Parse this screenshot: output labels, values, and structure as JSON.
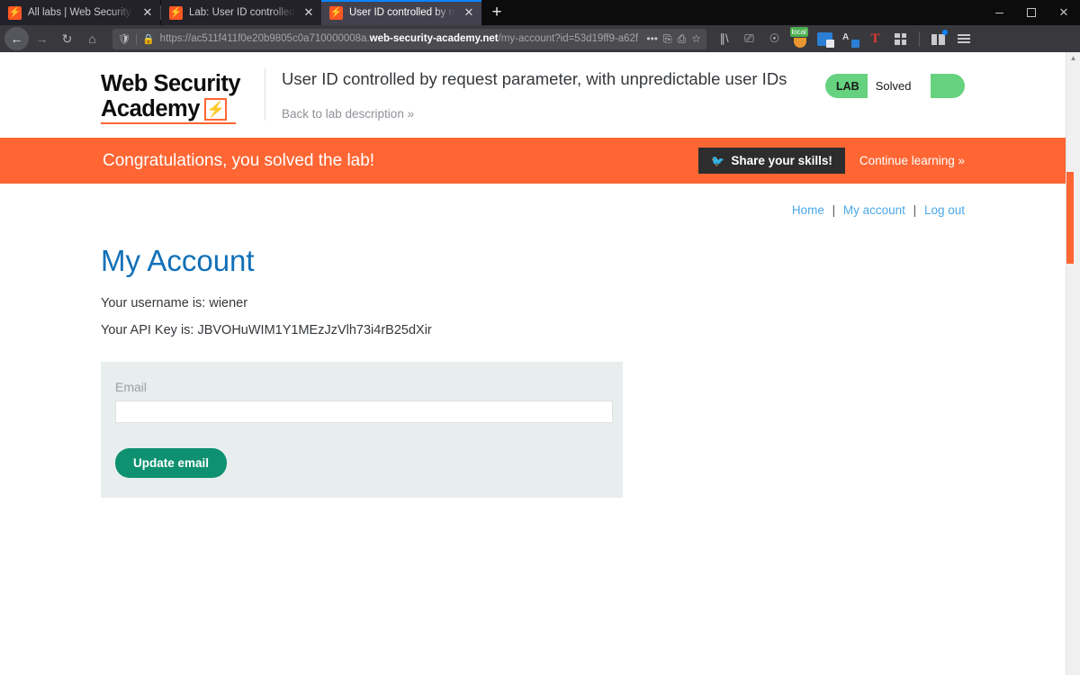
{
  "browser": {
    "tabs": [
      {
        "title": "All labs | Web Security Academy",
        "favicon": "lightning-icon",
        "active": false
      },
      {
        "title": "Lab: User ID controlled by requ",
        "favicon": "lightning-icon",
        "active": false
      },
      {
        "title": "User ID controlled by request p",
        "favicon": "lightning-icon",
        "active": true
      }
    ],
    "new_tab_label": "+",
    "window_controls": {
      "minimize": "–",
      "maximize": "❐",
      "close": "✕"
    },
    "nav": {
      "back": "←",
      "forward": "→",
      "reload": "↻",
      "home": "⌂"
    },
    "url": {
      "shield_icon": "shield-icon",
      "lock_icon": "lock-icon",
      "scheme_host_prefix": "https://ac511f411f0e20b9805c0a710000008a.",
      "domain": "web-security-academy.net",
      "path": "/my-account?id=53d19ff9-a62f",
      "more_icon": "•••",
      "reader_icon": "reader-icon",
      "translate_icon": "translate-icon",
      "bookmark_icon": "☆"
    },
    "toolbar_icons": [
      "library-icon",
      "sidebar-icon",
      "account-icon",
      "local-extension-icon",
      "dictionary-extension-icon",
      "translate-extension-icon",
      "text-tool-icon",
      "extensions-grid-icon",
      "gift-icon",
      "menu-icon"
    ],
    "local_badge": "local"
  },
  "lab": {
    "logo_line1": "Web Security",
    "logo_line2": "Academy",
    "logo_mark": "lightning-bolt-icon",
    "title": "User ID controlled by request parameter, with unpredictable user IDs",
    "back_link": "Back to lab description »",
    "status_tag": "LAB",
    "status_state": "Solved",
    "status_color": "#66d27f"
  },
  "banner": {
    "message": "Congratulations, you solved the lab!",
    "share_button": "Share your skills!",
    "share_icon": "twitter-bird-icon",
    "continue_link": "Continue learning »",
    "background_color": "#ff6633"
  },
  "topnav": {
    "items": [
      "Home",
      "My account",
      "Log out"
    ],
    "separator": "|",
    "link_color": "#4ca8e8"
  },
  "account": {
    "heading": "My Account",
    "heading_color": "#1170b8",
    "username_line": "Your username is: wiener",
    "apikey_line": "Your API Key is: JBVOHuWIM1Y1MEzJzVlh73i4rB25dXir",
    "username": "wiener",
    "api_key": "JBVOHuWIM1Y1MEzJzVlh73i4rB25dXir"
  },
  "form": {
    "label": "Email",
    "input_value": "",
    "input_placeholder": "",
    "submit_label": "Update email",
    "submit_color": "#0e9170",
    "background_color": "#e8edee"
  },
  "scrollbar": {
    "up_arrow": "▲",
    "thumb_color": "#ff6633"
  }
}
